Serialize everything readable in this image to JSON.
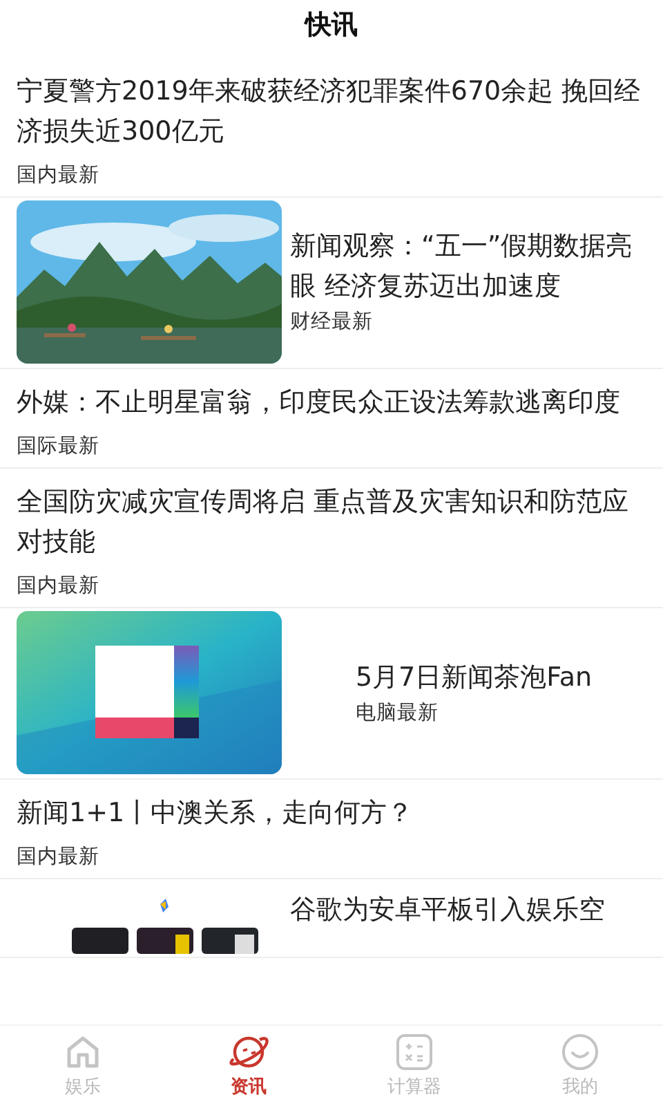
{
  "header": {
    "title": "快讯"
  },
  "news": [
    {
      "kind": "text",
      "title": "宁夏警方2019年来破获经济犯罪案件670余起 挽回经济损失近300亿元",
      "category": "国内最新"
    },
    {
      "title": "新闻观察：“五一”假期数据亮眼 经济复苏迈出加速度",
      "category": "财经最新"
    },
    {
      "kind": "text",
      "title": "外媒：不止明星富翁，印度民众正设法筹款逃离印度",
      "category": "国际最新"
    },
    {
      "kind": "text",
      "title": "全国防灾减灾宣传周将启 重点普及灾害知识和防范应对技能",
      "category": "国内最新"
    },
    {
      "title": "5月7日新闻茶泡Fan",
      "category": "电脑最新"
    },
    {
      "kind": "text",
      "title": "新闻1+1丨中澳关系，走向何方？",
      "category": "国内最新"
    },
    {
      "title": "谷歌为安卓平板引入娱乐空"
    }
  ],
  "tabs": [
    {
      "label": "娱乐",
      "selected": false
    },
    {
      "label": "资讯",
      "selected": true
    },
    {
      "label": "计算器",
      "selected": false
    },
    {
      "label": "我的",
      "selected": false
    }
  ]
}
